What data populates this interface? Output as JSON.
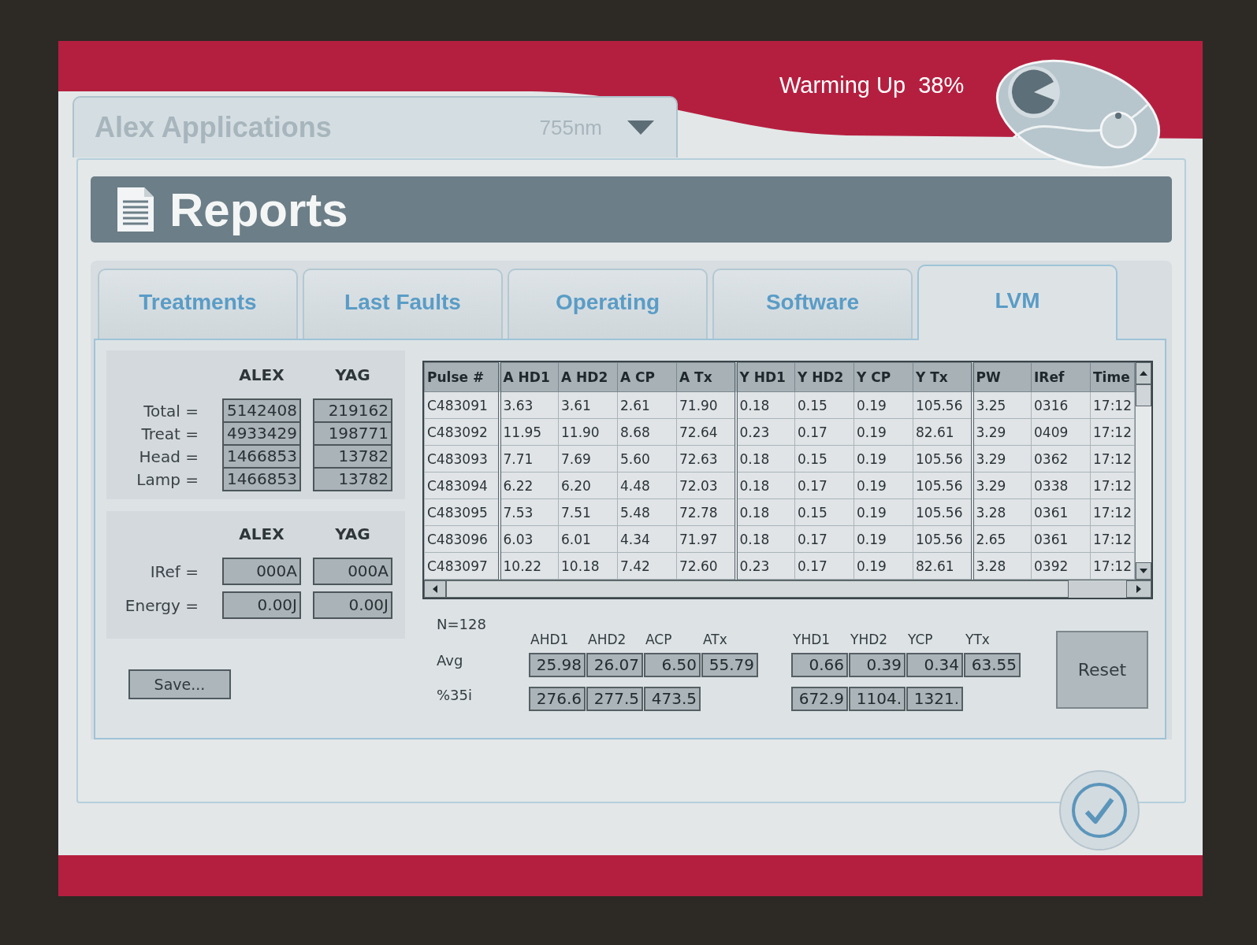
{
  "header": {
    "status": "Warming Up  38%"
  },
  "app_selector": {
    "value": "Alex Applications",
    "wavelength": "755nm",
    "disabled": true
  },
  "page_title": "Reports",
  "tabs": [
    {
      "label": "Treatments",
      "selected": false
    },
    {
      "label": "Last Faults",
      "selected": false
    },
    {
      "label": "Operating",
      "selected": false
    },
    {
      "label": "Software",
      "selected": false
    },
    {
      "label": "LVM",
      "selected": true
    }
  ],
  "counters": {
    "columns": [
      "ALEX",
      "YAG"
    ],
    "rows": [
      {
        "label": "Total =",
        "values": [
          "5142408",
          "219162"
        ]
      },
      {
        "label": "Treat =",
        "values": [
          "4933429",
          "198771"
        ]
      },
      {
        "label": "Head =",
        "values": [
          "1466853",
          "13782"
        ]
      },
      {
        "label": "Lamp =",
        "values": [
          "1466853",
          "13782"
        ]
      }
    ]
  },
  "readings": {
    "columns": [
      "ALEX",
      "YAG"
    ],
    "rows": [
      {
        "label": "IRef =",
        "values": [
          "000A",
          "000A"
        ]
      },
      {
        "label": "Energy =",
        "values": [
          "0.00J",
          "0.00J"
        ]
      }
    ]
  },
  "save_button": "Save...",
  "pulse_table": {
    "columns": [
      {
        "label": "Pulse #",
        "group_start": false
      },
      {
        "label": "A HD1",
        "group_start": true
      },
      {
        "label": "A HD2",
        "group_start": false
      },
      {
        "label": "A CP",
        "group_start": false
      },
      {
        "label": "A Tx",
        "group_start": false
      },
      {
        "label": "Y HD1",
        "group_start": true
      },
      {
        "label": "Y HD2",
        "group_start": false
      },
      {
        "label": "Y CP",
        "group_start": false
      },
      {
        "label": "Y Tx",
        "group_start": false
      },
      {
        "label": "PW",
        "group_start": true
      },
      {
        "label": "IRef",
        "group_start": false
      },
      {
        "label": "Time",
        "group_start": false
      }
    ],
    "rows": [
      [
        "C483091",
        "3.63",
        "3.61",
        "2.61",
        "71.90",
        "0.18",
        "0.15",
        "0.19",
        "105.56",
        "3.25",
        "0316",
        "17:12"
      ],
      [
        "C483092",
        "11.95",
        "11.90",
        "8.68",
        "72.64",
        "0.23",
        "0.17",
        "0.19",
        "82.61",
        "3.29",
        "0409",
        "17:12"
      ],
      [
        "C483093",
        "7.71",
        "7.69",
        "5.60",
        "72.63",
        "0.18",
        "0.15",
        "0.19",
        "105.56",
        "3.29",
        "0362",
        "17:12"
      ],
      [
        "C483094",
        "6.22",
        "6.20",
        "4.48",
        "72.03",
        "0.18",
        "0.17",
        "0.19",
        "105.56",
        "3.29",
        "0338",
        "17:12"
      ],
      [
        "C483095",
        "7.53",
        "7.51",
        "5.48",
        "72.78",
        "0.18",
        "0.15",
        "0.19",
        "105.56",
        "3.28",
        "0361",
        "17:12"
      ],
      [
        "C483096",
        "6.03",
        "6.01",
        "4.34",
        "71.97",
        "0.18",
        "0.17",
        "0.19",
        "105.56",
        "2.65",
        "0361",
        "17:12"
      ],
      [
        "C483097",
        "10.22",
        "10.18",
        "7.42",
        "72.60",
        "0.23",
        "0.17",
        "0.19",
        "82.61",
        "3.28",
        "0392",
        "17:12"
      ]
    ]
  },
  "stats": {
    "count": "N=128",
    "row_labels": [
      "Avg",
      "%35i"
    ],
    "groups": [
      {
        "columns": [
          "AHD1",
          "AHD2",
          "ACP",
          "ATx"
        ],
        "avg": [
          "25.98",
          "26.07",
          "6.50",
          "55.79"
        ],
        "pct": [
          "276.6",
          "277.5",
          "473.5"
        ]
      },
      {
        "columns": [
          "YHD1",
          "YHD2",
          "YCP",
          "YTx"
        ],
        "avg": [
          "0.66",
          "0.39",
          "0.34",
          "63.55"
        ],
        "pct": [
          "672.9",
          "1104.",
          "1321."
        ]
      }
    ]
  },
  "reset_button": "Reset"
}
